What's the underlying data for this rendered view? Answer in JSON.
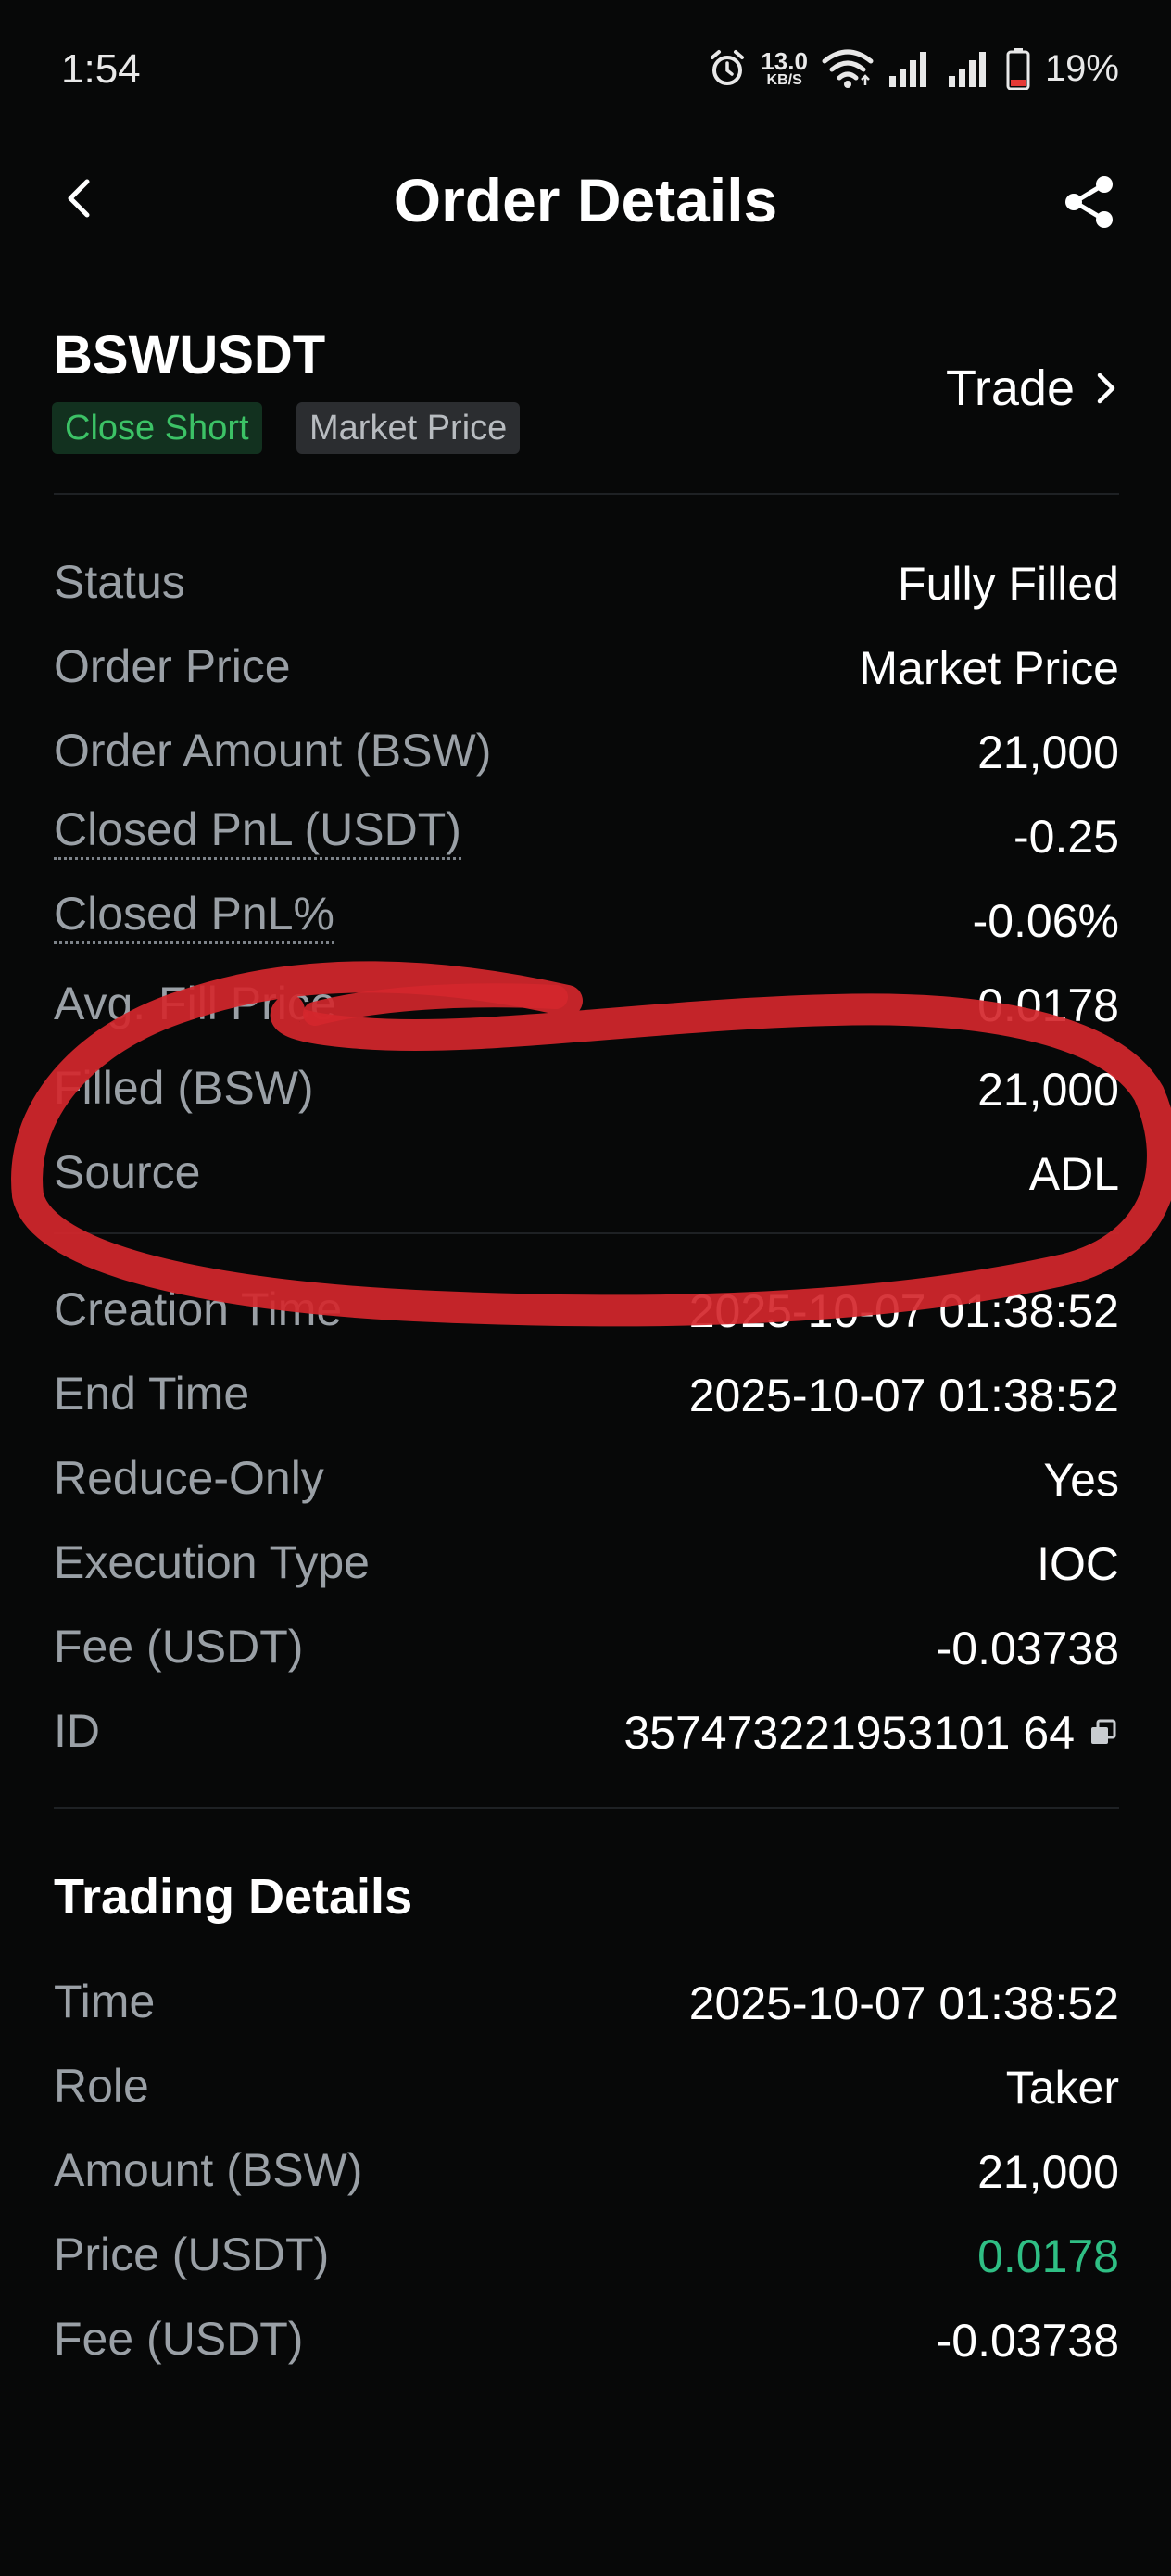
{
  "status_bar": {
    "time": "1:54",
    "net_speed": "13.0",
    "net_speed_unit": "KB/S",
    "battery": "19%",
    "icons": [
      "alarm-icon",
      "wifi-icon",
      "signal-icon",
      "signal-icon",
      "battery-icon"
    ]
  },
  "header": {
    "title": "Order Details",
    "back_icon": "chevron-left-icon",
    "share_icon": "share-icon"
  },
  "order": {
    "symbol": "BSWUSDT",
    "side_tag": "Close Short",
    "type_tag": "Market Price",
    "trade_link": "Trade"
  },
  "details": [
    {
      "label": "Status",
      "value": "Fully Filled"
    },
    {
      "label": "Order Price",
      "value": "Market Price"
    },
    {
      "label": "Order Amount (BSW)",
      "value": "21,000"
    },
    {
      "label": "Closed PnL (USDT)",
      "value": "-0.25"
    },
    {
      "label": "Closed PnL%",
      "value": "-0.06%"
    },
    {
      "label": "Avg. Fill Price",
      "value": "0.0178"
    },
    {
      "label": "Filled (BSW)",
      "value": "21,000"
    },
    {
      "label": "Source",
      "value": "ADL"
    }
  ],
  "details2": [
    {
      "label": "Creation Time",
      "value": "2025-10-07 01:38:52"
    },
    {
      "label": "End Time",
      "value": "2025-10-07 01:38:52"
    },
    {
      "label": "Reduce-Only",
      "value": "Yes"
    },
    {
      "label": "Execution Type",
      "value": "IOC"
    },
    {
      "label": "Fee (USDT)",
      "value": "-0.03738"
    },
    {
      "label": "ID",
      "value": "357473221953101 64"
    }
  ],
  "trading_details": {
    "title": "Trading Details",
    "rows": [
      {
        "label": "Time",
        "value": "2025-10-07 01:38:52"
      },
      {
        "label": "Role",
        "value": "Taker"
      },
      {
        "label": "Amount (BSW)",
        "value": "21,000"
      },
      {
        "label": "Price (USDT)",
        "value": "0.0178"
      },
      {
        "label": "Fee (USDT)",
        "value": "-0.03738"
      }
    ]
  },
  "colors": {
    "background": "#070808",
    "label": "#9aa0a6",
    "green_tag": "#3cc266",
    "price_green": "#2fbf84",
    "annotation_red": "#d4272c"
  }
}
